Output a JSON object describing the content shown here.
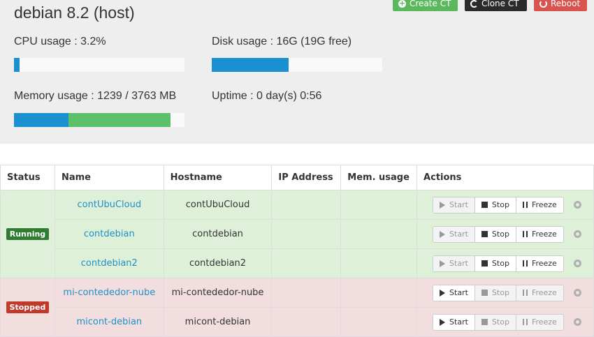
{
  "host": {
    "title": "debian 8.2 (host)",
    "buttons": {
      "create": "Create CT",
      "clone": "Clone CT",
      "reboot": "Reboot"
    },
    "cpu": {
      "label": "CPU usage : 3.2%",
      "percent": 3.2
    },
    "disk": {
      "label": "Disk usage : 16G (19G free)",
      "used_fraction": 0.45
    },
    "memory": {
      "label": "Memory usage : 1239 / 3763 MB",
      "segments": [
        0.32,
        0.6
      ]
    },
    "uptime": {
      "label": "Uptime : 0 day(s) 0:56"
    }
  },
  "colors": {
    "bar_primary": "#1a90d0",
    "bar_secondary": "#5cbf6a",
    "running": "#2e7d32",
    "stopped": "#c0392b"
  },
  "table": {
    "headers": [
      "Status",
      "Name",
      "Hostname",
      "IP Address",
      "Mem. usage",
      "Actions"
    ],
    "actions": {
      "start": "Start",
      "stop": "Stop",
      "freeze": "Freeze"
    },
    "groups": {
      "running": {
        "label": "Running"
      },
      "stopped": {
        "label": "Stopped"
      }
    },
    "rows": [
      {
        "name": "contUbuCloud",
        "hostname": "contUbuCloud",
        "ip": "",
        "mem": ""
      },
      {
        "name": "contdebian",
        "hostname": "contdebian",
        "ip": "",
        "mem": ""
      },
      {
        "name": "contdebian2",
        "hostname": "contdebian2",
        "ip": "",
        "mem": ""
      },
      {
        "name": "mi-contededor-nube",
        "hostname": "mi-contededor-nube",
        "ip": "",
        "mem": ""
      },
      {
        "name": "micont-debian",
        "hostname": "micont-debian",
        "ip": "",
        "mem": ""
      }
    ]
  }
}
